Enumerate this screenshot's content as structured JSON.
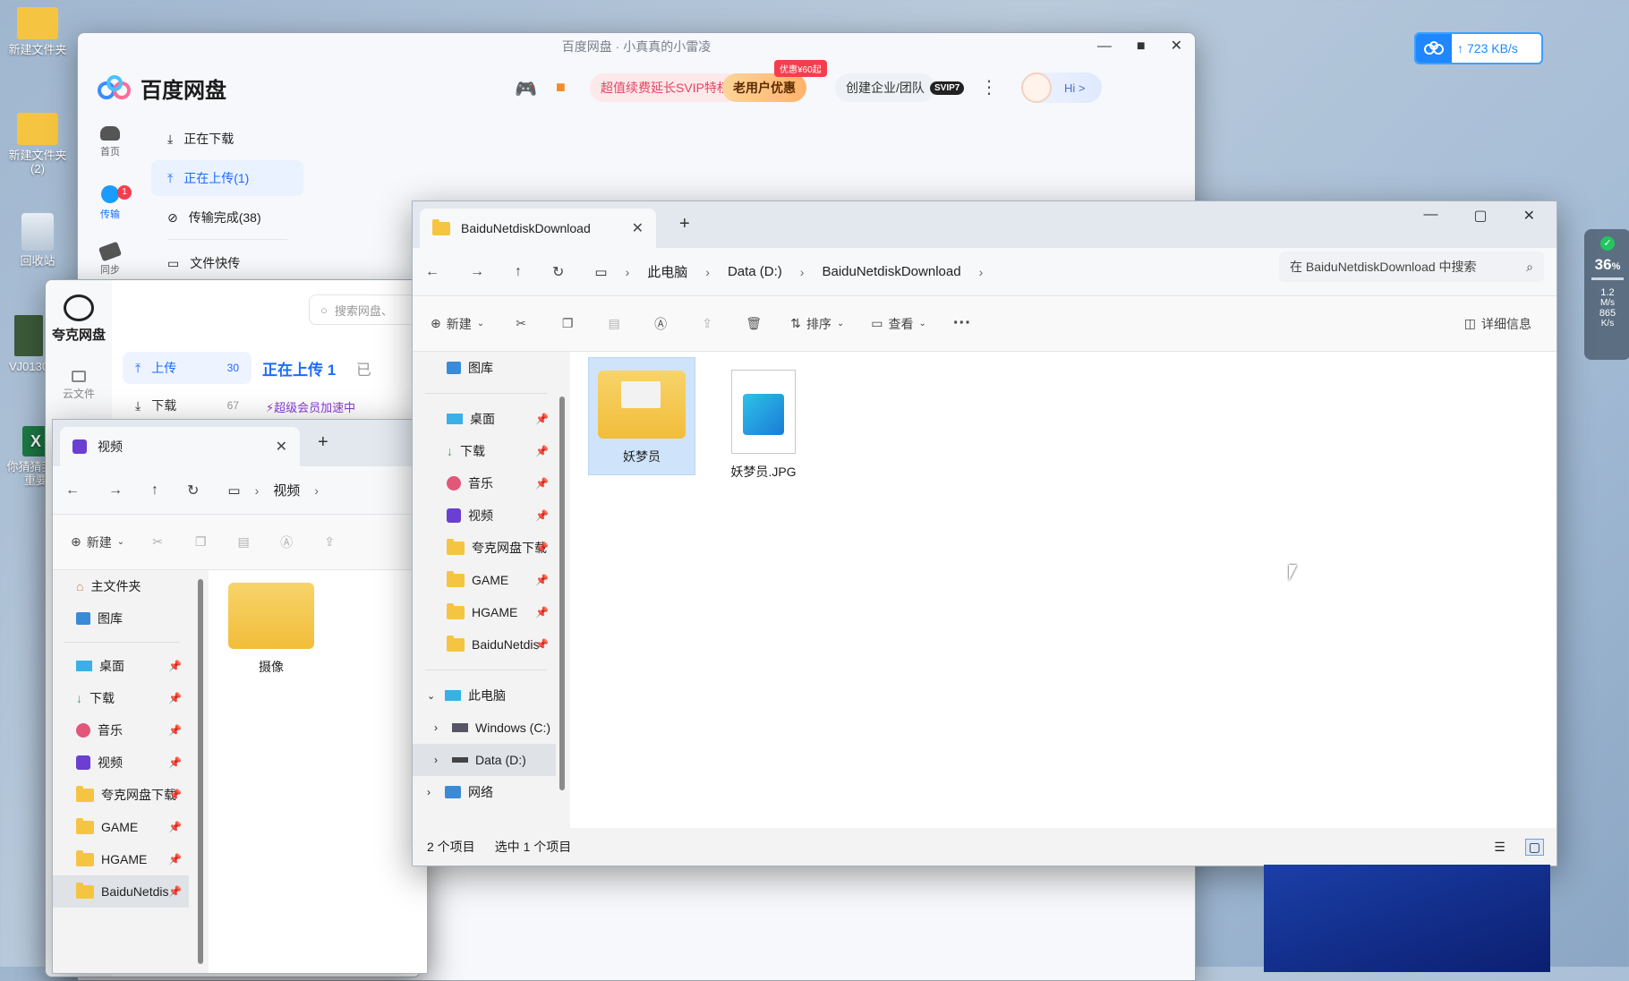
{
  "desktop": {
    "icons": [
      {
        "label": "新建文件夹"
      },
      {
        "label": "新建文件夹 (2)"
      },
      {
        "label": "回收站"
      },
      {
        "label": "VJ0130"
      },
      {
        "label": "你猜猜我们 重要"
      }
    ]
  },
  "baidu": {
    "window_title": "百度网盘 · 小真真的小雷凌",
    "app_name": "百度网盘",
    "promo_svip": "超值续费延长SVIP特权",
    "promo_old_user": "老用户优惠",
    "promo_badge": "优惠¥60起",
    "enterprise": "创建企业/团队",
    "svip_badge": "SVIP7",
    "hi": "Hi >",
    "sidebar": [
      {
        "label": "首页"
      },
      {
        "label": "传输",
        "badge": "1"
      },
      {
        "label": "同步"
      }
    ],
    "menu": [
      {
        "label": "正在下载"
      },
      {
        "label": "正在上传(1)"
      },
      {
        "label": "传输完成(38)"
      },
      {
        "label": "文件快传"
      }
    ]
  },
  "speed_widget": {
    "upload_speed": "723 KB/s"
  },
  "net_monitor": {
    "percent": "36",
    "percent_suffix": "%",
    "up": "1.2",
    "up_unit": "M/s",
    "down": "865",
    "down_unit": "K/s"
  },
  "quark": {
    "app_name": "夸克网盘",
    "search_placeholder": "搜索网盘、",
    "sidebar": [
      {
        "label": "云文件"
      }
    ],
    "upload": {
      "label": "上传",
      "count": "30"
    },
    "download": {
      "label": "下载",
      "count": "67"
    },
    "heading": "正在上传 1",
    "heading_tail": "已",
    "promo": "超级会员加速中"
  },
  "explorer_video": {
    "tab_title": "视频",
    "breadcrumb": [
      "视频"
    ],
    "new_label": "新建",
    "nav_items": [
      {
        "label": "主文件夹"
      },
      {
        "label": "图库"
      },
      {
        "label": "桌面"
      },
      {
        "label": "下载"
      },
      {
        "label": "音乐"
      },
      {
        "label": "视频"
      },
      {
        "label": "夸克网盘下载"
      },
      {
        "label": "GAME"
      },
      {
        "label": "HGAME"
      },
      {
        "label": "BaiduNetdis"
      }
    ],
    "files": [
      {
        "name": "摄像"
      }
    ]
  },
  "explorer_main": {
    "tab_title": "BaiduNetdiskDownload",
    "breadcrumb": [
      "此电脑",
      "Data (D:)",
      "BaiduNetdiskDownload"
    ],
    "search_placeholder": "在 BaiduNetdiskDownload 中搜索",
    "toolbar": {
      "new_label": "新建",
      "sort_label": "排序",
      "view_label": "查看",
      "details_label": "详细信息"
    },
    "nav_items": [
      {
        "label": "图库"
      },
      {
        "label": "桌面"
      },
      {
        "label": "下载"
      },
      {
        "label": "音乐"
      },
      {
        "label": "视频"
      },
      {
        "label": "夸克网盘下载"
      },
      {
        "label": "GAME"
      },
      {
        "label": "HGAME"
      },
      {
        "label": "BaiduNetdis"
      },
      {
        "label": "此电脑"
      },
      {
        "label": "Windows (C:)"
      },
      {
        "label": "Data (D:)"
      },
      {
        "label": "网络"
      }
    ],
    "files": [
      {
        "name": "妖梦员"
      },
      {
        "name": "妖梦员.JPG"
      }
    ],
    "status": {
      "count": "2 个项目",
      "selected": "选中 1 个项目"
    }
  }
}
